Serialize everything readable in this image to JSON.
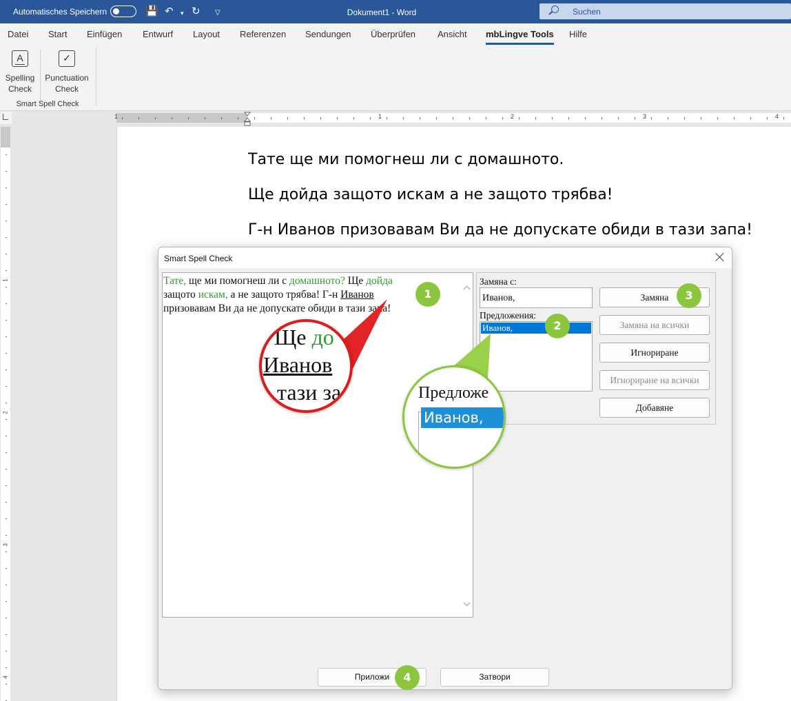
{
  "titlebar": {
    "autosave_label": "Automatisches Speichern",
    "document_title": "Dokument1  -  Word",
    "search_placeholder": "Suchen",
    "bg_color": "#2b579a"
  },
  "menu_tabs": [
    "Datei",
    "Start",
    "Einfügen",
    "Entwurf",
    "Layout",
    "Referenzen",
    "Sendungen",
    "Überprüfen",
    "Ansicht",
    "mbLingve Tools",
    "Hilfe"
  ],
  "active_tab": "mbLingve Tools",
  "ribbon": {
    "spelling_line1": "Spelling",
    "spelling_line2": "Check",
    "punct_line1": "Punctuation",
    "punct_line2": "Check",
    "group_label": "Smart Spell Check",
    "spelling_icon_letter": "A"
  },
  "ruler": {
    "h_numbers": [
      "1",
      "1",
      "2",
      "3",
      "4"
    ],
    "v_numbers": [
      "1",
      "2",
      "3",
      "4"
    ]
  },
  "document": {
    "lines": [
      "Тате ще ми помогнеш ли с домашното.",
      "Ще дойда защото искам а не защото трябва!",
      "Г-н Иванов призовавам Ви да не допускате обиди в тази запа!"
    ]
  },
  "dialog": {
    "title": "Smart Spell Check",
    "text": {
      "l1_a": "Тате,",
      "l1_b": " ще ми помогнеш ли с ",
      "l1_c": "домашното?",
      "l1_d": " Ще ",
      "l1_e": "дойда",
      "l2_a": "защото ",
      "l2_b": "искам,",
      "l2_c": " а не защото трябва! Г-н ",
      "l2_d": "Иванов",
      "l3": "призовавам Ви да не допускате обиди в тази запа!"
    },
    "replace_label": "Замяна с:",
    "replace_value": "Иванов,",
    "suggestions_label": "Предложения:",
    "suggestions": [
      "Иванов,"
    ],
    "buttons": {
      "replace": "Замяна",
      "replace_all": "Замяна на всички",
      "ignore": "Игнориране",
      "ignore_all": "Игнориране на всички",
      "add": "Добавяне",
      "apply": "Приложи",
      "close": "Затвори"
    }
  },
  "callouts": [
    "1",
    "2",
    "3",
    "4"
  ],
  "zoom_red": {
    "line1_a": ". Ще ",
    "line1_b": "до",
    "line2": "Иванов",
    "line3": "тази за"
  },
  "zoom_green": {
    "label": "Предложе",
    "item": "Иванов,"
  },
  "colors": {
    "accent_blue": "#2b579a",
    "highlight_green": "#2e9b2e",
    "badge_green": "#8cc63f",
    "zoom_red": "#d81e1e",
    "selection_blue": "#0078d7"
  }
}
